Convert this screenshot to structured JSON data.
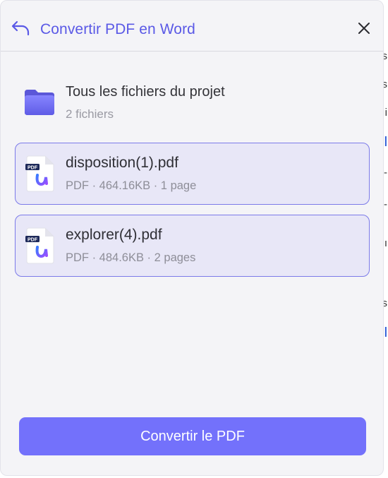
{
  "header": {
    "title": "Convertir PDF en Word",
    "back_icon": "undo-arrow-icon",
    "close_icon": "close-icon",
    "accent": "#5a59e6"
  },
  "project": {
    "title": "Tous les fichiers du projet",
    "subtitle": "2 fichiers",
    "icon": "folder-icon"
  },
  "files": [
    {
      "name": "disposition(1).pdf",
      "meta": "PDF · 464.16KB · 1 page",
      "icon": "pdf-file-icon",
      "badge": "PDF"
    },
    {
      "name": "explorer(4).pdf",
      "meta": "PDF · 484.6KB · 2 pages",
      "icon": "pdf-file-icon",
      "badge": "PDF"
    }
  ],
  "action": {
    "convert_label": "Convertir le PDF",
    "color": "#7371fb"
  }
}
